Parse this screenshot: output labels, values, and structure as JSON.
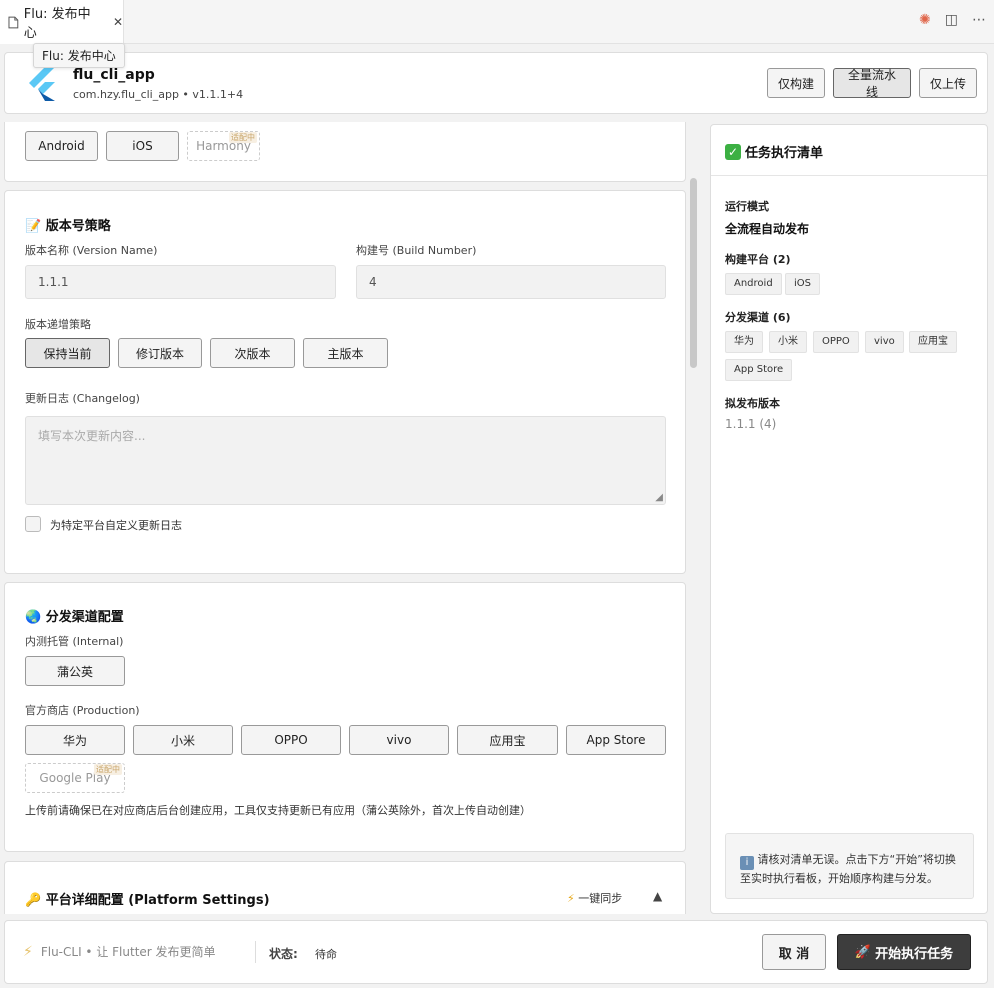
{
  "tab": {
    "title": "Flu: 发布中心",
    "close": "✕",
    "tooltip": "Flu: 发布中心"
  },
  "header": {
    "app_name": "flu_cli_app",
    "app_sub": "com.hzy.flu_cli_app • v1.1.1+4",
    "buttons": {
      "build_only": "仅构建",
      "full_pipeline": "全量流水线",
      "upload_only": "仅上传"
    }
  },
  "platforms": {
    "android": "Android",
    "ios": "iOS",
    "harmony": "Harmony",
    "harmony_badge": "适配中"
  },
  "version": {
    "title": "版本号策略",
    "name_label": "版本名称 (Version Name)",
    "name_value": "1.1.1",
    "build_label": "构建号 (Build Number)",
    "build_value": "4",
    "strategy_label": "版本递增策略",
    "strategies": [
      "保持当前",
      "修订版本",
      "次版本",
      "主版本"
    ],
    "changelog_label": "更新日志 (Changelog)",
    "changelog_placeholder": "填写本次更新内容...",
    "custom_changelog": "为特定平台自定义更新日志"
  },
  "channels": {
    "title": "分发渠道配置",
    "internal_label": "内测托管 (Internal)",
    "internal": [
      "蒲公英"
    ],
    "production_label": "官方商店 (Production)",
    "production": [
      "华为",
      "小米",
      "OPPO",
      "vivo",
      "应用宝",
      "App Store"
    ],
    "google_play": "Google Play",
    "google_badge": "适配中",
    "note": "上传前请确保已在对应商店后台创建应用，工具仅支持更新已有应用（蒲公英除外，首次上传自动创建）"
  },
  "platform_settings": {
    "title": "平台详细配置 (Platform Settings)",
    "sync": "一键同步",
    "toggle": "▲"
  },
  "checklist": {
    "title": "任务执行清单",
    "mode_label": "运行模式",
    "mode_value": "全流程自动发布",
    "platforms_label": "构建平台 (2)",
    "platforms": [
      "Android",
      "iOS"
    ],
    "channels_label": "分发渠道 (6)",
    "channels": [
      "华为",
      "小米",
      "OPPO",
      "vivo",
      "应用宝",
      "App Store"
    ],
    "version_label": "拟发布版本",
    "version_value": "1.1.1 (4)",
    "note": "请核对清单无误。点击下方“开始”将切换至实时执行看板，开始顺序构建与分发。"
  },
  "footer": {
    "brand": "Flu-CLI • 让 Flutter 发布更简单",
    "status_label": "状态:",
    "status_value": "待命",
    "cancel": "取 消",
    "start": "开始执行任务"
  },
  "colors": {
    "flutter_light": "#5ac8f5",
    "flutter_dark": "#0d5aa7",
    "check_green": "#3cb043",
    "start_bg": "#3d3d3d"
  }
}
